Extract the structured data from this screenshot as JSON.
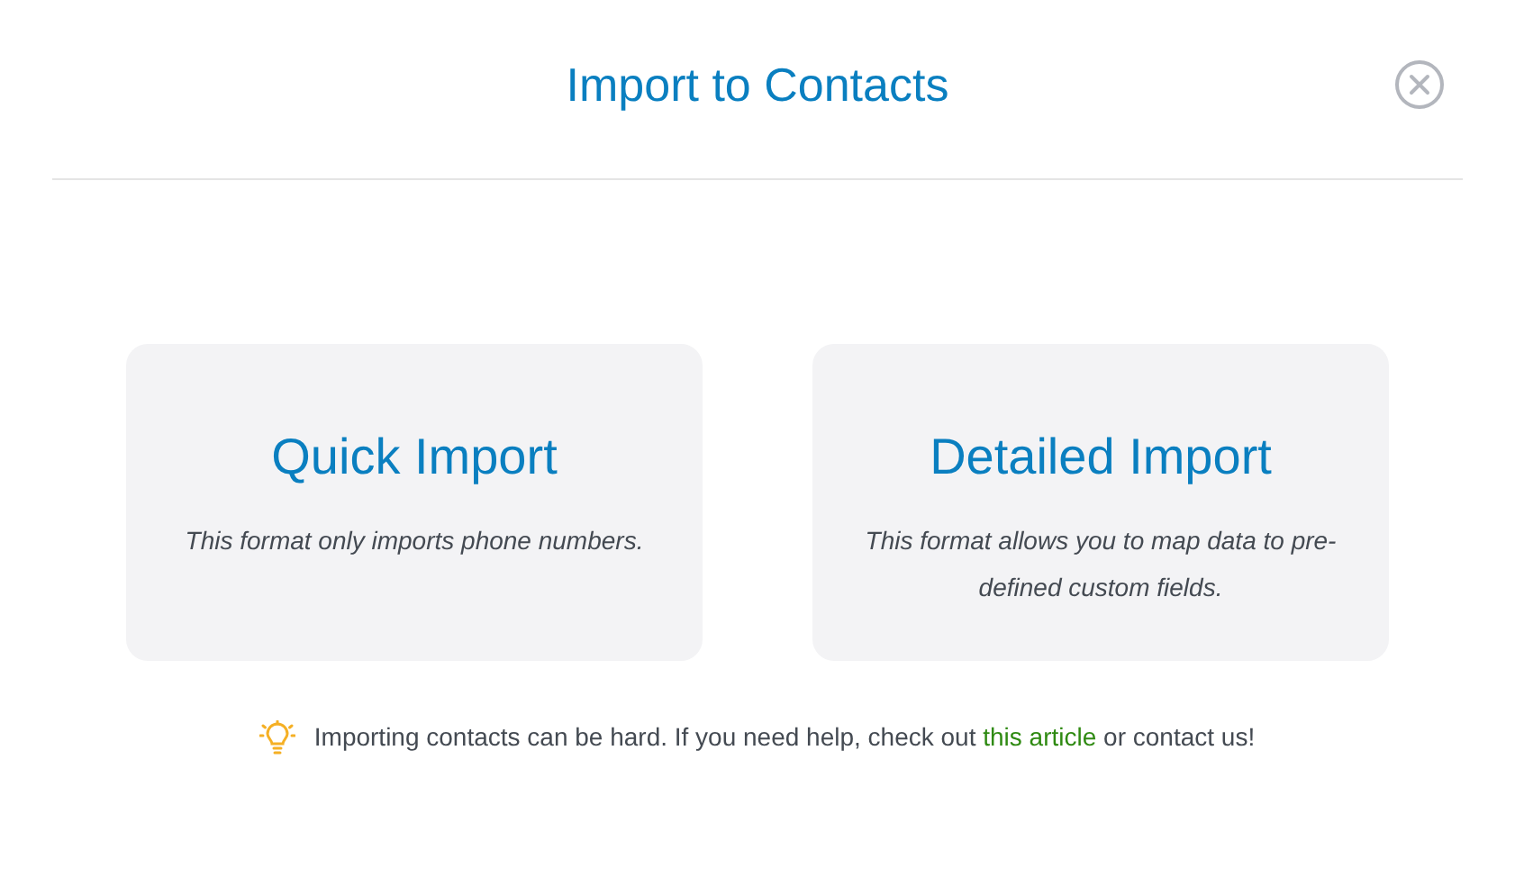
{
  "dialog": {
    "title": "Import to Contacts"
  },
  "options": [
    {
      "title": "Quick Import",
      "description": "This format only imports phone numbers."
    },
    {
      "title": "Detailed Import",
      "description": "This format allows you to map data to pre-defined custom fields."
    }
  ],
  "tip": {
    "before": "Importing contacts can be hard. If you need help, check out ",
    "link": "this article",
    "after": " or contact us!"
  }
}
